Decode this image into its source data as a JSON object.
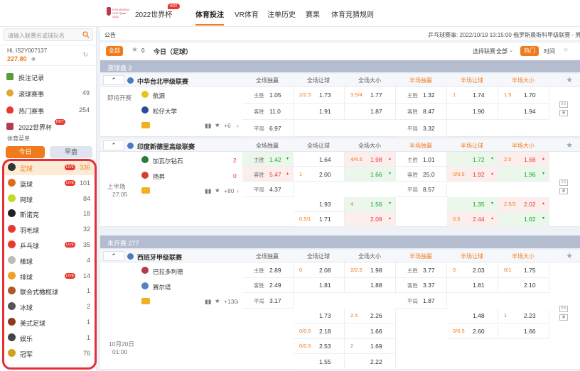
{
  "nav": {
    "wc_label": "2022世界杯",
    "hot": "HOT",
    "logo_text": "FIFA WORLD CUP Qatar 2022",
    "tabs": [
      "体育投注",
      "VR体育",
      "注单历史",
      "赛果",
      "体育竞猜规则"
    ]
  },
  "search": {
    "placeholder": "请输入联赛名或球队名"
  },
  "user": {
    "name": "Hi, IS2Y007137",
    "balance": "227.80"
  },
  "menu": [
    {
      "label": "投注记录",
      "count": ""
    },
    {
      "label": "滚球赛事",
      "count": "49"
    },
    {
      "label": "热门赛事",
      "count": "254"
    },
    {
      "label": "2022世界杯",
      "count": ""
    }
  ],
  "sidebar": {
    "section_title": "体育菜单",
    "today": "今日",
    "early": "早盘"
  },
  "sports": [
    {
      "label": "足球",
      "live": "LIVE",
      "count": "336",
      "color": "#333"
    },
    {
      "label": "篮球",
      "live": "LIVE",
      "count": "101",
      "color": "#e06a1f"
    },
    {
      "label": "网球",
      "live": "",
      "count": "84",
      "color": "#c7d62a"
    },
    {
      "label": "斯诺克",
      "live": "",
      "count": "18",
      "color": "#222"
    },
    {
      "label": "羽毛球",
      "live": "",
      "count": "32",
      "color": "#e8382f"
    },
    {
      "label": "乒乓球",
      "live": "LIVE",
      "count": "35",
      "color": "#e8382f"
    },
    {
      "label": "棒球",
      "live": "",
      "count": "4",
      "color": "#bbb"
    },
    {
      "label": "排球",
      "live": "LIVE",
      "count": "14",
      "color": "#f0a020"
    },
    {
      "label": "联合式橄榄球",
      "live": "",
      "count": "1",
      "color": "#b0562a"
    },
    {
      "label": "冰球",
      "live": "",
      "count": "2",
      "color": "#555"
    },
    {
      "label": "美式足球",
      "live": "",
      "count": "1",
      "color": "#8a3d1a"
    },
    {
      "label": "娱乐",
      "live": "",
      "count": "1",
      "color": "#444"
    },
    {
      "label": "冠军",
      "live": "",
      "count": "76",
      "color": "#d4a017"
    }
  ],
  "notice": {
    "label": "公告",
    "text": "乒乓球赛事: 2022/10/19 13:15:00 俄罗斯晨斯科甲级联赛 - 男单"
  },
  "filter": {
    "all": "全部",
    "fav_count": "0",
    "title": "今日（足球）",
    "select_label": "选择联赛",
    "select_value": "全部",
    "hot": "热门",
    "time": "时间"
  },
  "sections": {
    "live": "滚球盘 2",
    "upcoming": "未开赛 277"
  },
  "columns": [
    "全场独赢",
    "全场让球",
    "全场大小",
    "半场独赢",
    "半场让球",
    "半场大小"
  ],
  "leagues": [
    {
      "name": "中华台北甲级联赛",
      "home": "航源",
      "away": "松仔大学",
      "status": "即将开赛",
      "more": "+6",
      "r1": {
        "m": "主胜",
        "mv": "1.05",
        "h": "2/2.5",
        "hv": "1.73",
        "ou": "3.5/4",
        "ouv": "1.77",
        "hm": "主胜",
        "hmv": "1.32",
        "hh": "1",
        "hhv": "1.74",
        "hou": "1.5",
        "houv": "1.70"
      },
      "r2": {
        "m": "客胜",
        "mv": "11.0",
        "hv": "1.91",
        "ouv": "1.87",
        "hm": "客胜",
        "hmv": "8.47",
        "hhv": "1.90",
        "houv": "1.94"
      },
      "r3": {
        "m": "平局",
        "mv": "6.97",
        "hm": "平局",
        "hmv": "3.32"
      }
    },
    {
      "name": "印度新德里高级联赛",
      "home": "加瓦尔钻石",
      "away": "扬昇",
      "home_score": "2",
      "away_score": "0",
      "status": "上半场",
      "clock": "27:05",
      "more": "+80",
      "r1": {
        "m": "主胜",
        "mv": "1.42",
        "hv": "1.64",
        "ou": "4/4.5",
        "ouv": "1.98",
        "hm": "主胜",
        "hmv": "1.01",
        "hhv": "1.72",
        "hou": "2.5",
        "houv": "1.68"
      },
      "r2": {
        "m": "客胜",
        "mv": "5.47",
        "h": "1",
        "hv": "2.00",
        "ouv": "1.66",
        "hm": "客胜",
        "hmv": "25.0",
        "hh": "0/0.5",
        "hhv": "1.92",
        "houv": "1.96"
      },
      "r3": {
        "m": "平局",
        "mv": "4.37",
        "hm": "平局",
        "hmv": "8.57"
      },
      "r4": {
        "hv": "1.93",
        "ou": "4",
        "ouv": "1.56",
        "hhv": "1.35",
        "hou": "2.5/3",
        "houv": "2.02"
      },
      "r5": {
        "h": "0.5/1",
        "hv": "1.71",
        "ouv": "2.09",
        "hh": "0.5",
        "hhv": "2.44",
        "houv": "1.62"
      }
    },
    {
      "name": "西班牙甲级联赛",
      "home": "巴拉多利德",
      "away": "赛尔塔",
      "status_date": "10月20日",
      "status_time": "01:00",
      "more": "+130",
      "r1": {
        "m": "主胜",
        "mv": "2.89",
        "h": "0",
        "hv": "2.08",
        "ou": "2/2.5",
        "ouv": "1.98",
        "hm": "主胜",
        "hmv": "3.77",
        "hh": "0",
        "hhv": "2.03",
        "hou": "0/1",
        "houv": "1.75"
      },
      "r2": {
        "m": "客胜",
        "mv": "2.49",
        "hv": "1.81",
        "ouv": "1.88",
        "hm": "客胜",
        "hmv": "3.37",
        "hhv": "1.81",
        "houv": "2.10"
      },
      "r3": {
        "m": "平局",
        "mv": "3.17",
        "hm": "平局",
        "hmv": "1.87"
      },
      "r4": {
        "hv": "1.73",
        "ou": "2.5",
        "ouv": "2.26",
        "hhv": "1.48",
        "hou": "1",
        "houv": "2.23"
      },
      "r5": {
        "h": "0/0.5",
        "hv": "2.18",
        "ouv": "1.66",
        "hh": "0/0.5",
        "hhv": "2.60",
        "houv": "1.66"
      },
      "r6": {
        "h": "0/0.5",
        "hv": "2.53",
        "ou": "2",
        "ouv": "1.69"
      },
      "r7": {
        "hv": "1.55",
        "ouv": "2.22"
      }
    }
  ]
}
